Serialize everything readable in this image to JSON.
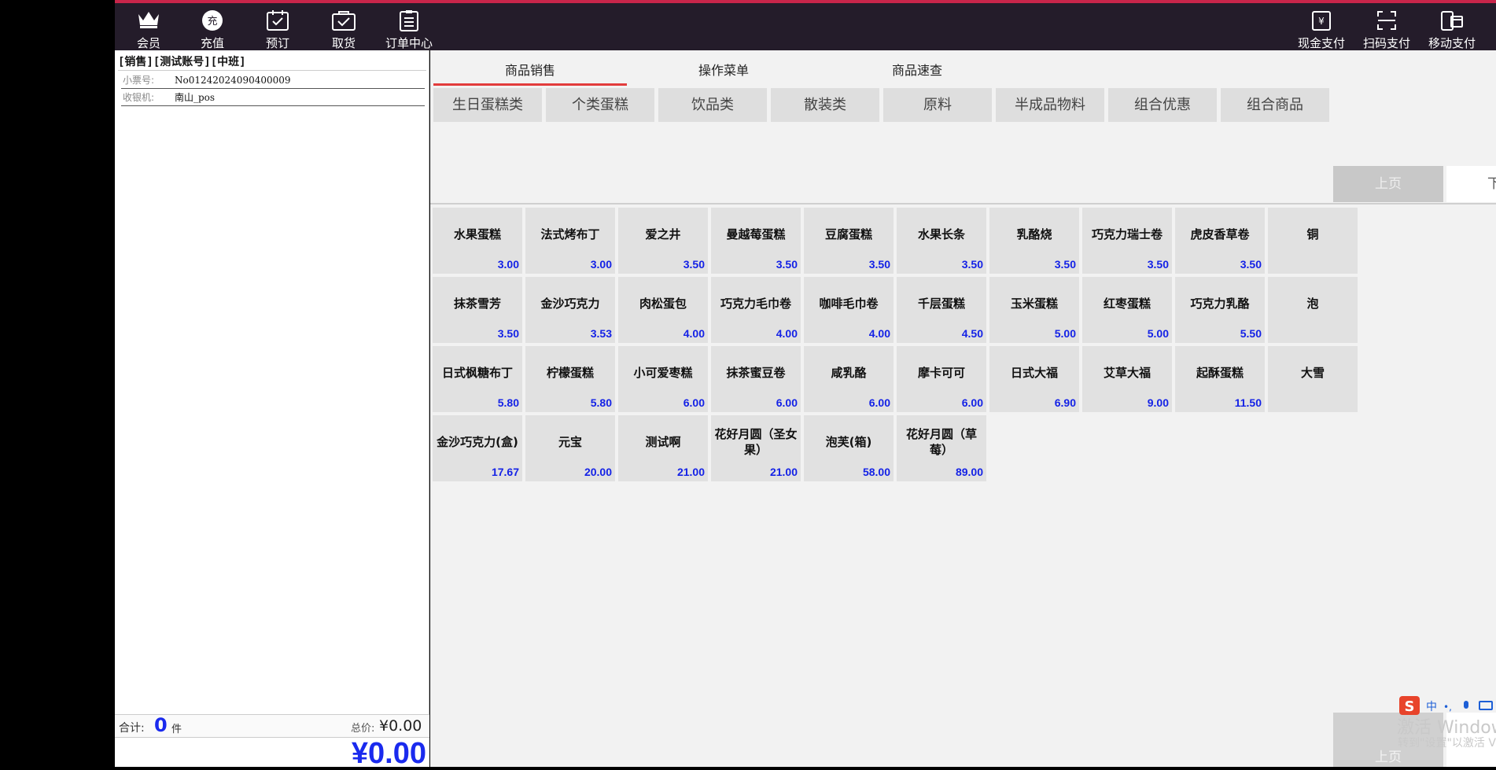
{
  "toolbar_left": [
    {
      "icon": "crown-icon",
      "label": "会员"
    },
    {
      "icon": "recharge-icon",
      "label": "充值"
    },
    {
      "icon": "calendar-check-icon",
      "label": "预订"
    },
    {
      "icon": "pickup-icon",
      "label": "取货"
    },
    {
      "icon": "order-list-icon",
      "label": "订单中心"
    }
  ],
  "toolbar_right": [
    {
      "icon": "cash-icon",
      "label": "现金支付"
    },
    {
      "icon": "scan-icon",
      "label": "扫码支付"
    },
    {
      "icon": "mobile-pay-icon",
      "label": "移动支付"
    }
  ],
  "recharge_glyph": "充",
  "cash_glyph": "¥",
  "left": {
    "header": "[销售][测试账号][中班]",
    "ticket_label": "小票号:",
    "ticket_no": "No01242024090400009",
    "cashier_label": "收银机:",
    "cashier": "南山_pos",
    "total_label": "合计:",
    "count": "0",
    "count_unit": "件",
    "sum_label": "总价:",
    "sum": "¥0.00",
    "grand_total": "¥0.00"
  },
  "tabs": [
    "商品销售",
    "操作菜单",
    "商品速查"
  ],
  "active_tab": 0,
  "categories": [
    "生日蛋糕类",
    "个类蛋糕",
    "饮品类",
    "散装类",
    "原料",
    "半成品物料",
    "组合优惠",
    "组合商品"
  ],
  "pager": {
    "prev": "上页",
    "next": "下"
  },
  "products": [
    {
      "name": "水果蛋糕",
      "price": "3.00"
    },
    {
      "name": "法式烤布丁",
      "price": "3.00"
    },
    {
      "name": "爱之井",
      "price": "3.50"
    },
    {
      "name": "曼越莓蛋糕",
      "price": "3.50"
    },
    {
      "name": "豆腐蛋糕",
      "price": "3.50"
    },
    {
      "name": "水果长条",
      "price": "3.50"
    },
    {
      "name": "乳酪烧",
      "price": "3.50"
    },
    {
      "name": "巧克力瑞士卷",
      "price": "3.50"
    },
    {
      "name": "虎皮香草卷",
      "price": "3.50"
    },
    {
      "name": "铜",
      "price": ""
    },
    {
      "name": "抹茶雪芳",
      "price": "3.50"
    },
    {
      "name": "金沙巧克力",
      "price": "3.53"
    },
    {
      "name": "肉松蛋包",
      "price": "4.00"
    },
    {
      "name": "巧克力毛巾卷",
      "price": "4.00"
    },
    {
      "name": "咖啡毛巾卷",
      "price": "4.00"
    },
    {
      "name": "千层蛋糕",
      "price": "4.50"
    },
    {
      "name": "玉米蛋糕",
      "price": "5.00"
    },
    {
      "name": "红枣蛋糕",
      "price": "5.00"
    },
    {
      "name": "巧克力乳酪",
      "price": "5.50"
    },
    {
      "name": "泡",
      "price": ""
    },
    {
      "name": "日式枫糖布丁",
      "price": "5.80"
    },
    {
      "name": "柠檬蛋糕",
      "price": "5.80"
    },
    {
      "name": "小可爱枣糕",
      "price": "6.00"
    },
    {
      "name": "抹茶蜜豆卷",
      "price": "6.00"
    },
    {
      "name": "咸乳酪",
      "price": "6.00"
    },
    {
      "name": "摩卡可可",
      "price": "6.00"
    },
    {
      "name": "日式大福",
      "price": "6.90"
    },
    {
      "name": "艾草大福",
      "price": "9.00"
    },
    {
      "name": "起酥蛋糕",
      "price": "11.50"
    },
    {
      "name": "大雪",
      "price": ""
    },
    {
      "name": "金沙巧克力(盒)",
      "price": "17.67"
    },
    {
      "name": "元宝",
      "price": "20.00"
    },
    {
      "name": "测试啊",
      "price": "21.00"
    },
    {
      "name": "花好月圆（圣女果）",
      "price": "21.00"
    },
    {
      "name": "泡芙(箱)",
      "price": "58.00"
    },
    {
      "name": "花好月圆（草莓）",
      "price": "89.00"
    }
  ],
  "watermark": {
    "line1": "激活 Window",
    "line2": "转到\"设置\"以激活 V"
  },
  "ime": {
    "zh": "中",
    "punct": "•,"
  },
  "colors": {
    "accent": "#e23c3c",
    "price": "#1422e6",
    "toolbar": "#241c2a",
    "card": "#e1e1e1"
  }
}
